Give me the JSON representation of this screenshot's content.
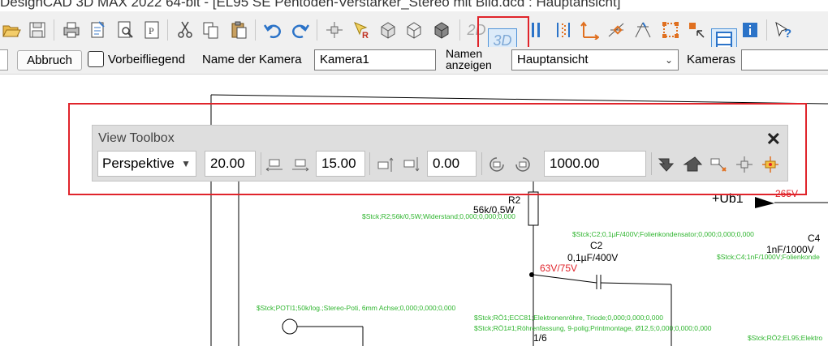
{
  "window": {
    "title": "DesignCAD 3D MAX 2022 64-bit - [EL95 SE Pentoden-Verstärker_Stereo mit Bild.dcd : Hauptansicht]"
  },
  "toolbar": {
    "icons": [
      "open-folder-icon",
      "save-icon",
      "print-icon",
      "export-icon",
      "print-preview-icon",
      "page-setup-icon",
      "cut-icon",
      "copy-icon",
      "paste-icon",
      "undo-icon",
      "redo-icon",
      "point-icon",
      "reference-icon",
      "render-icon",
      "render-frame-icon",
      "render-solid-icon",
      "mode-2d-icon",
      "mode-3d-icon",
      "column-icon",
      "grid-snap-icon",
      "axes-icon",
      "snap-icon",
      "perspective-icon",
      "select-icon",
      "arrow-select-icon",
      "layout-icon",
      "info-icon",
      "help-pointer-icon"
    ],
    "label_2d": "2D",
    "label_3d": "3D"
  },
  "camera_bar": {
    "cancel_label": "Abbruch",
    "pass_by_label": "Vorbeifliegend",
    "camera_name_label": "Name der Kamera",
    "camera_name_value": "Kamera1",
    "show_names_label": "Namen anzeigen",
    "view_select_value": "Hauptansicht",
    "cameras_label": "Kameras",
    "cameras_value": ""
  },
  "view_toolbox": {
    "title": "View Toolbox",
    "projection_value": "Perspektive",
    "fov_value": "20.00",
    "move_value": "15.00",
    "elevation_value": "0.00",
    "rotation_value": "1000.00"
  },
  "schematic": {
    "labels": {
      "r2_name": "R2",
      "r2_value": "56k/0,5W",
      "r2_stock": "$Stck;R2;56k/0,5W;Widerstand;0,000;0,000;0,000",
      "ub1": "+Ub1",
      "v265": "265V",
      "c2_stock": "$Stck;C2;0,1µF/400V;Folienkondensator;0,000;0,000;0,000",
      "c2_name": "C2",
      "c2_value": "0,1µF/400V",
      "c4_name": "C4",
      "c4_value": "1nF/1000V",
      "c4_stock": "$Stck;C4;1nF/1000V;Folienkonde",
      "v63_75": "63V/75V",
      "poti_stock": "$Stck;POTI1;50k/log.;Stereo-Poti, 6mm Achse;0,000;0,000;0,000",
      "ro1_stock": "$Stck;RÖ1;ECC81;Elektronenröhre, Triode;0,000;0,000;0,000",
      "ro1_socket_stock": "$Stck;RÖ1#1;Röhrenfassung, 9-polig;Printmontage, Ø12,5;0,000;0,000;0,000",
      "ro2_stock": "$Stck;RÖ2;EL95;Elektro",
      "pin_1_6": "1/6"
    }
  },
  "colors": {
    "highlight_red": "#e0242b",
    "stock_green": "#2fb52f",
    "active_blue": "#4f93d8"
  }
}
